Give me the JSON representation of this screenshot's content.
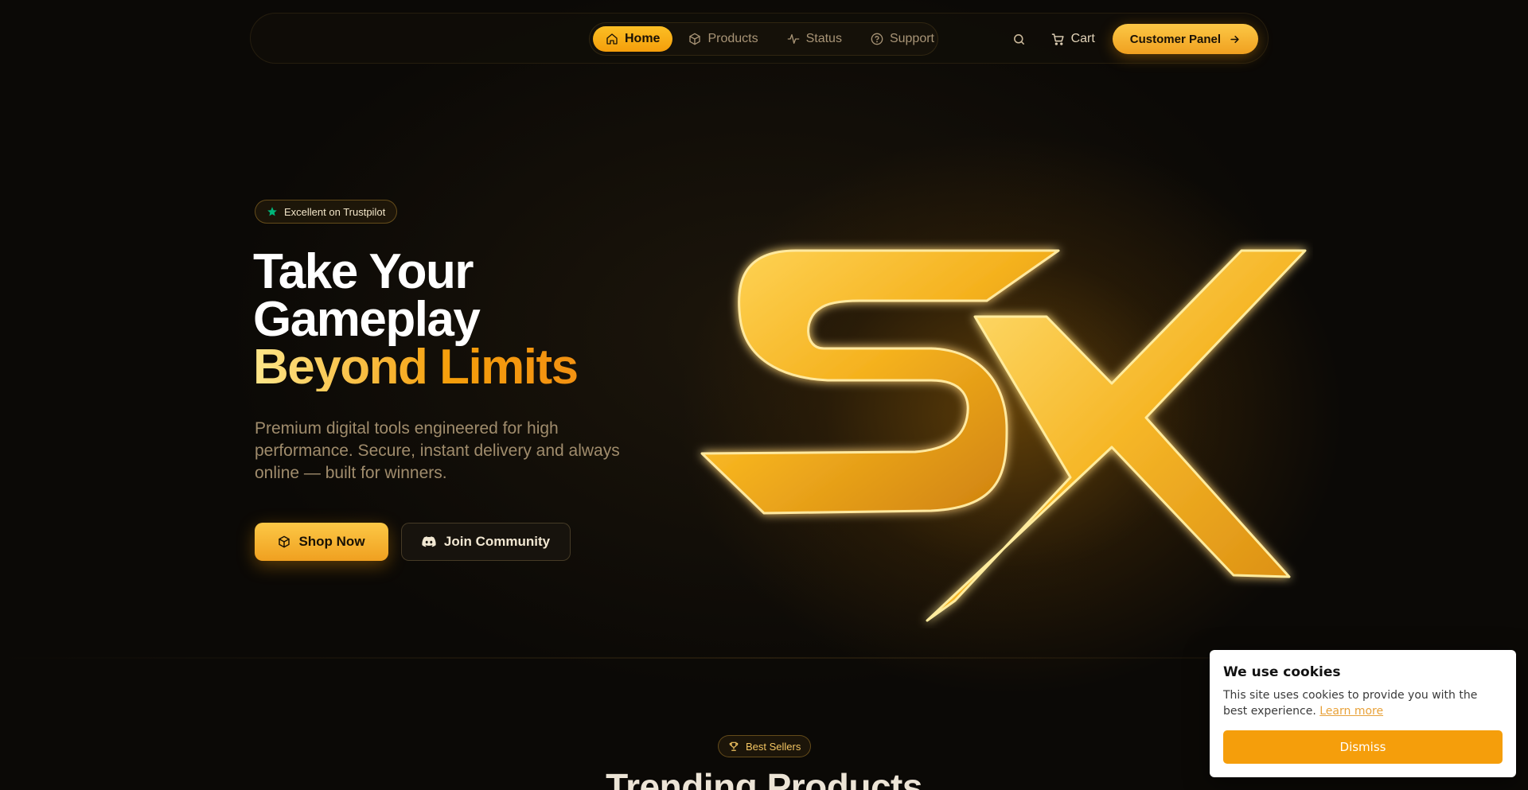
{
  "nav": {
    "items": [
      {
        "label": "Home",
        "icon": "home-icon",
        "active": true
      },
      {
        "label": "Products",
        "icon": "box-icon",
        "active": false
      },
      {
        "label": "Status",
        "icon": "activity-icon",
        "active": false
      },
      {
        "label": "Support",
        "icon": "help-circle-icon",
        "active": false
      }
    ],
    "cart_label": "Cart",
    "panel_label": "Customer Panel"
  },
  "hero": {
    "badge": "Excellent on Trustpilot",
    "title_line1": "Take Your",
    "title_line2": "Gameplay",
    "title_highlight": "Beyond Limits",
    "subtitle": "Premium digital tools engineered for high performance. Secure, instant delivery and always online — built for winners.",
    "shop_label": "Shop Now",
    "join_label": "Join Community",
    "logo_text": "SX"
  },
  "section": {
    "badge": "Best Sellers",
    "title": "Trending Products"
  },
  "cookie": {
    "title": "We use cookies",
    "text": "This site uses cookies to provide you with the best experience.",
    "link": "Learn more",
    "button": "Dismiss"
  },
  "colors": {
    "accent": "#f59e0b",
    "accent_light": "#fcc846",
    "background": "#0b0906",
    "trustpilot_star": "#00b67a"
  }
}
